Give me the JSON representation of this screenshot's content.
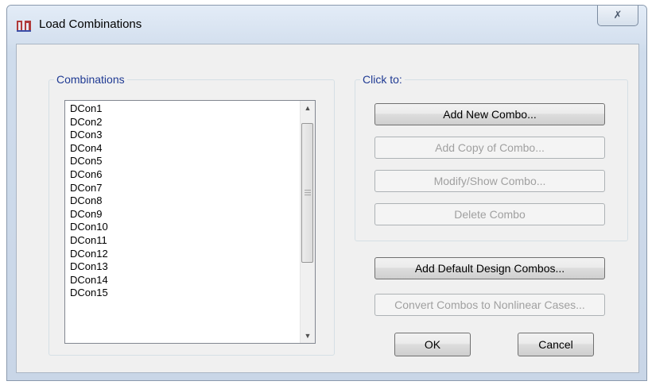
{
  "window": {
    "title": "Load Combinations",
    "close_glyph": "✗",
    "app_icon": "structure-building-icon"
  },
  "combinations": {
    "legend": "Combinations",
    "items": [
      "DCon1",
      "DCon2",
      "DCon3",
      "DCon4",
      "DCon5",
      "DCon6",
      "DCon7",
      "DCon8",
      "DCon9",
      "DCon10",
      "DCon11",
      "DCon12",
      "DCon13",
      "DCon14",
      "DCon15"
    ]
  },
  "click_to": {
    "legend": "Click to:",
    "add_new": "Add New Combo...",
    "add_copy": "Add Copy of Combo...",
    "modify_show": "Modify/Show Combo...",
    "delete": "Delete Combo"
  },
  "actions": {
    "add_default": "Add Default Design Combos...",
    "convert": "Convert Combos to Nonlinear Cases...",
    "ok": "OK",
    "cancel": "Cancel"
  }
}
